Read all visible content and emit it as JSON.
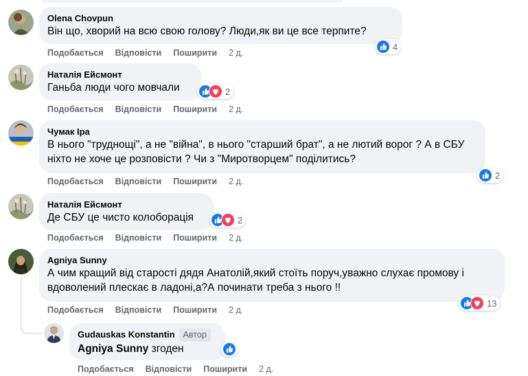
{
  "actions": {
    "like": "Подобається",
    "reply": "Відповісти",
    "share": "Поширити"
  },
  "comments": [
    {
      "author": "Olena Chovpun",
      "text": "Він що, хворий на всю свою голову? Люди,як ви це все терпите?",
      "time": "2 д.",
      "reactions": "4",
      "reaction_icons": [
        "like"
      ]
    },
    {
      "author": "Наталія Ейсмонт",
      "text": "Ганьба люди чого мовчали",
      "time": "2 д.",
      "reactions": "2",
      "reaction_icons": [
        "like",
        "love"
      ]
    },
    {
      "author": "Чумак Іра",
      "text": "В нього \"труднощі\", а не \"війна\", в нього \"старший брат\", а не лютий ворог ? А в СБУ ніхто не хоче це розповісти ? Чи з \"Миротворцем\" поділитись?",
      "time": "2 д.",
      "reactions": "2",
      "reaction_icons": [
        "like"
      ]
    },
    {
      "author": "Наталія Ейсмонт",
      "text": "Де СБУ це чисто колоборація",
      "time": "2 д.",
      "reactions": "2",
      "reaction_icons": [
        "like",
        "love"
      ]
    },
    {
      "author": "Agniya Sunny",
      "text": "А чим кращий від старості дядя Анатолій,який стоїть поруч,уважно слухає промову і вдоволений плескає в ладоні,а?А починати треба з нього !!",
      "time": "2 д.",
      "reactions": "13",
      "reaction_icons": [
        "like",
        "love"
      ]
    }
  ],
  "reply": {
    "author": "Gudauskas Konstantin",
    "author_badge": "Автор",
    "mention": "Agniya Sunny",
    "text": " згоден",
    "time": "2 д.",
    "reaction_icons": [
      "like"
    ]
  },
  "colors": {
    "bubble": "#f0f2f5",
    "like": "#1877f2",
    "love": "#f33e58",
    "meta": "#65676b"
  }
}
